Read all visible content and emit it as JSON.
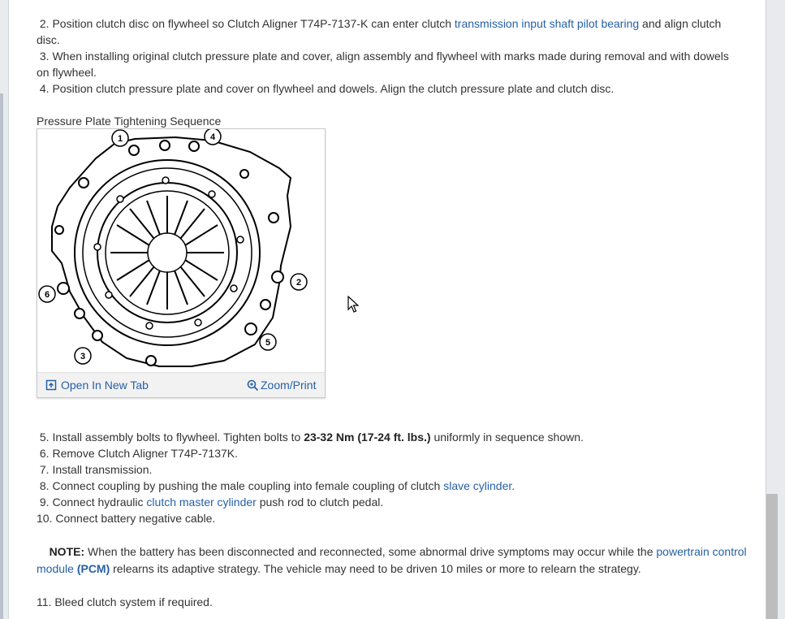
{
  "steps_top": {
    "s2_num": "2.",
    "s2_a": " Position clutch disc on flywheel so Clutch Aligner T74P-7137-K can enter clutch ",
    "s2_link": "transmission input shaft pilot bearing",
    "s2_b": " and align clutch",
    "s2_c": "disc.",
    "s3_num": "3.",
    "s3_a": " When installing original clutch pressure plate and cover, align assembly and flywheel with marks made during removal and with dowels",
    "s3_b": "on flywheel.",
    "s4_num": "4.",
    "s4_a": " Position clutch pressure plate and cover on flywheel and dowels. Align the clutch pressure plate and clutch disc."
  },
  "figure": {
    "caption": "Pressure Plate Tightening Sequence",
    "open_tab_label": "Open In New Tab",
    "zoom_label": "Zoom/Print",
    "callouts": [
      "1",
      "4",
      "2",
      "6",
      "3",
      "5"
    ]
  },
  "steps_bottom": {
    "s5_num": "5.",
    "s5_a": " Install assembly bolts to flywheel. Tighten bolts to ",
    "s5_bold": "23-32 Nm (17-24 ft. lbs.)",
    "s5_b": " uniformly in sequence shown.",
    "s6_num": "6.",
    "s6": " Remove Clutch Aligner T74P-7137K.",
    "s7_num": "7.",
    "s7": " Install transmission.",
    "s8_num": "8.",
    "s8_a": " Connect coupling by pushing the male coupling into female coupling of clutch ",
    "s8_link": "slave cylinder.",
    "s9_num": "9.",
    "s9_a": " Connect hydraulic ",
    "s9_link": "clutch master cylinder",
    "s9_b": " push rod to clutch pedal.",
    "s10_num": "10.",
    "s10": " Connect battery negative cable.",
    "note_label": "NOTE:",
    "note_a": " When the battery has been disconnected and reconnected, some abnormal drive symptoms may occur while the ",
    "note_link1": "powertrain control",
    "note_link2": "module",
    "note_pcm": "(PCM)",
    "note_b": " relearns its adaptive strategy. The vehicle may need to be driven 10 miles or more to relearn the strategy.",
    "s11_num": "11.",
    "s11": " Bleed clutch system if required."
  },
  "colors": {
    "link": "#2660a6",
    "text": "#333333",
    "scrollbar_thumb": "#bdbdbd"
  },
  "icons": {
    "open_tab": "open-new-tab-icon",
    "zoom": "magnifier-zoom-icon",
    "cursor": "mouse-pointer-icon"
  }
}
